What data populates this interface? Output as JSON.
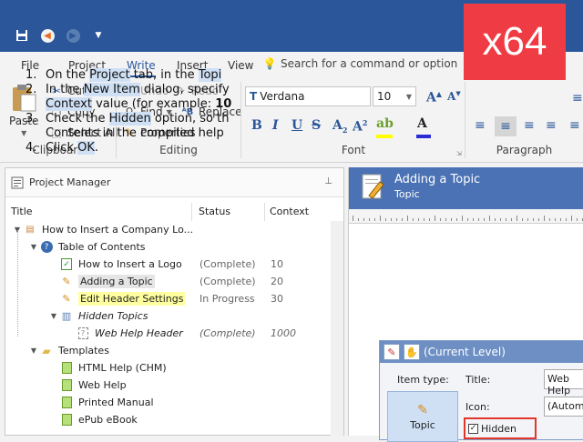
{
  "quick_access": {
    "icons": [
      "save-icon",
      "undo-icon",
      "redo-icon",
      "dropdown-icon"
    ]
  },
  "badge": {
    "text": "x64"
  },
  "ribbon": {
    "tabs": [
      "File",
      "Project",
      "Write",
      "Insert",
      "View"
    ],
    "active_tab": "Write",
    "search": {
      "placeholder": "Search for a command or option"
    },
    "clipboard": {
      "paste": "Paste",
      "cut": "Cut",
      "copy": "Copy",
      "select_all": "Select All",
      "label": "Clipboard"
    },
    "editing": {
      "undo": "Undo",
      "redo": "Redo",
      "find": "Find",
      "replace": "Replace",
      "properties": "Properties",
      "label": "Editing"
    },
    "font": {
      "family": "Verdana",
      "size": "10",
      "label": "Font"
    },
    "paragraph": {
      "label": "Paragraph"
    }
  },
  "project_manager": {
    "title": "Project Manager",
    "columns": {
      "title": "Title",
      "status": "Status",
      "context": "Context"
    },
    "rows": [
      {
        "title": "How to Insert a Company Lo...",
        "status": "",
        "context": ""
      },
      {
        "title": "Table of Contents",
        "status": "",
        "context": ""
      },
      {
        "title": "How to Insert a Logo",
        "status": "(Complete)",
        "context": "10"
      },
      {
        "title": "Adding a Topic",
        "status": "(Complete)",
        "context": "20"
      },
      {
        "title": "Edit Header Settings",
        "status": "In Progress",
        "context": "30"
      },
      {
        "title": "Hidden Topics",
        "status": "",
        "context": ""
      },
      {
        "title": "Web Help Header",
        "status": "(Complete)",
        "context": "1000"
      },
      {
        "title": "Templates",
        "status": "",
        "context": ""
      },
      {
        "title": "HTML Help (CHM)",
        "status": "",
        "context": ""
      },
      {
        "title": "Web Help",
        "status": "",
        "context": ""
      },
      {
        "title": "Printed Manual",
        "status": "",
        "context": ""
      },
      {
        "title": "ePub eBook",
        "status": "",
        "context": ""
      }
    ]
  },
  "topic": {
    "title": "Adding a Topic",
    "subtitle": "Topic",
    "steps": [
      {
        "num": "1.",
        "pre": "On the ",
        "hl": "Project",
        "post": " tab, in the ",
        "hl2": "Topi"
      },
      {
        "num": "2.",
        "pre": "In the ",
        "hl": "New Item",
        "post": " dialog, specify"
      },
      {
        "num": "",
        "pre": "",
        "hl": "Context",
        "post": " value (for example: ",
        "bold": "10"
      },
      {
        "num": "3.",
        "pre": "Check the ",
        "hl": "Hidden",
        "post": " option, so th"
      },
      {
        "num": "",
        "pre": "Contents in the compiled help",
        "hl": "",
        "post": ""
      },
      {
        "num": "4.",
        "pre": "Click ",
        "hl": "OK",
        "post": "."
      }
    ],
    "dialog": {
      "title": "(Current Level)",
      "item_type_label": "Item type:",
      "title_label": "Title:",
      "title_value": "Web Help",
      "icon_label": "Icon:",
      "icon_value": "(Automa",
      "topic_button": "Topic",
      "hidden_label": "Hidden"
    }
  }
}
